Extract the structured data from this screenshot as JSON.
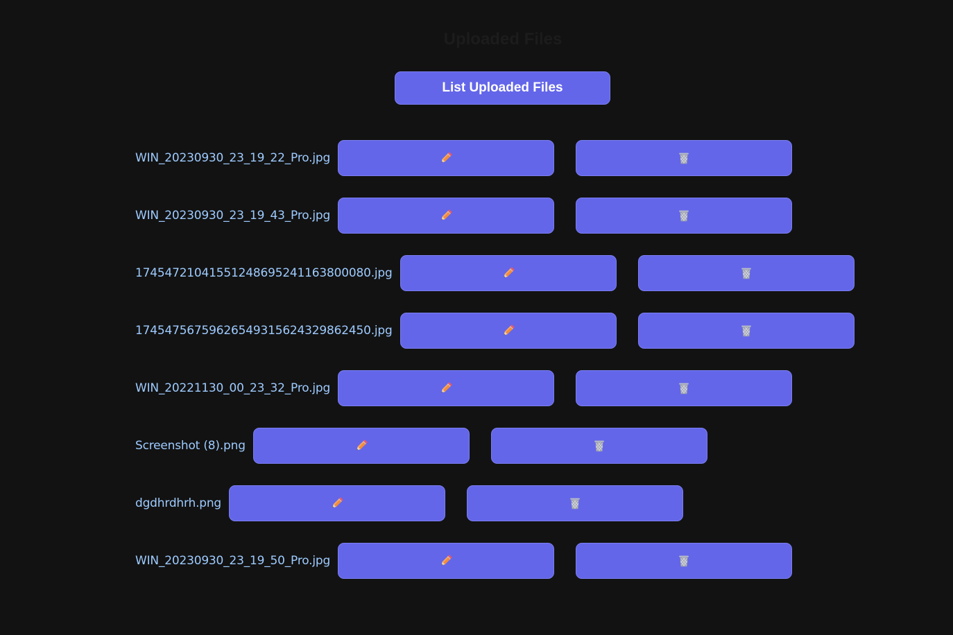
{
  "page": {
    "title": "Uploaded Files",
    "list_button_label": "List Uploaded Files"
  },
  "files": [
    {
      "name": "WIN_20230930_23_19_22_Pro.jpg"
    },
    {
      "name": "WIN_20230930_23_19_43_Pro.jpg"
    },
    {
      "name": "17454721041551248695241163800080.jpg"
    },
    {
      "name": "17454756759626549315624329862450.jpg"
    },
    {
      "name": "WIN_20221130_00_23_32_Pro.jpg"
    },
    {
      "name": "Screenshot (8).png"
    },
    {
      "name": "dgdhrdhrh.png"
    },
    {
      "name": "WIN_20230930_23_19_50_Pro.jpg"
    }
  ],
  "icons": {
    "edit": "pencil-icon",
    "delete": "wastebasket-icon"
  },
  "colors": {
    "background": "#121212",
    "button": "#6366e9",
    "file_name": "#9ecbff",
    "title": "#1c1c1c"
  }
}
